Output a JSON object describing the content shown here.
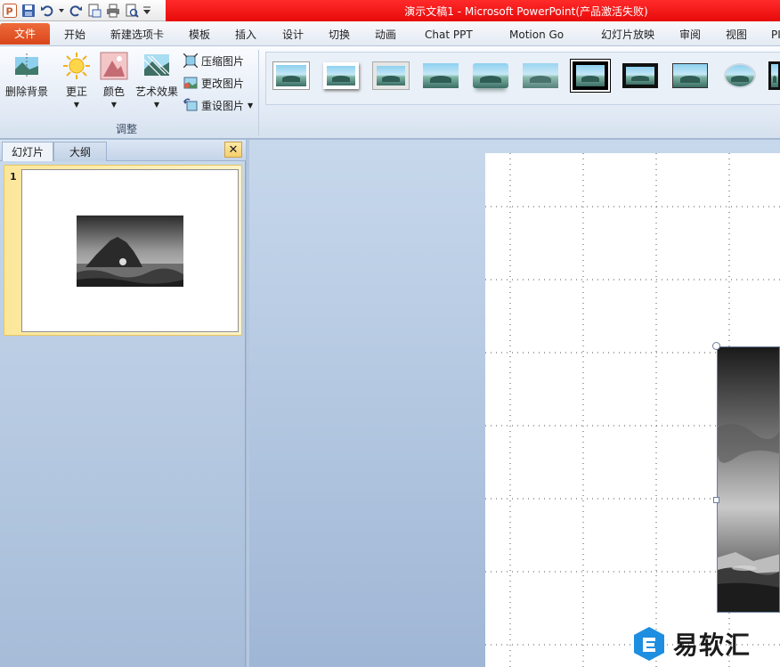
{
  "window": {
    "title": "演示文稿1  -  Microsoft PowerPoint(产品激活失败)"
  },
  "tabs": {
    "file": "文件",
    "home": "开始",
    "new_tab": "新建选项卡",
    "template": "模板",
    "insert": "插入",
    "design": "设计",
    "transitions": "切换",
    "animations": "动画",
    "chat_ppt": "Chat PPT",
    "motion_go": "Motion Go",
    "slideshow": "幻灯片放映",
    "review": "审阅",
    "view": "视图",
    "more": "PI"
  },
  "ribbon": {
    "remove_bg": "删除背景",
    "corrections": "更正",
    "color": "颜色",
    "artistic": "艺术效果",
    "compress": "压缩图片",
    "change": "更改图片",
    "reset": "重设图片",
    "group_adjust": "调整"
  },
  "panel": {
    "tab_slides": "幻灯片",
    "tab_outline": "大纲",
    "close": "✕",
    "slide_number": "1"
  },
  "watermark": {
    "text": "易软汇"
  }
}
